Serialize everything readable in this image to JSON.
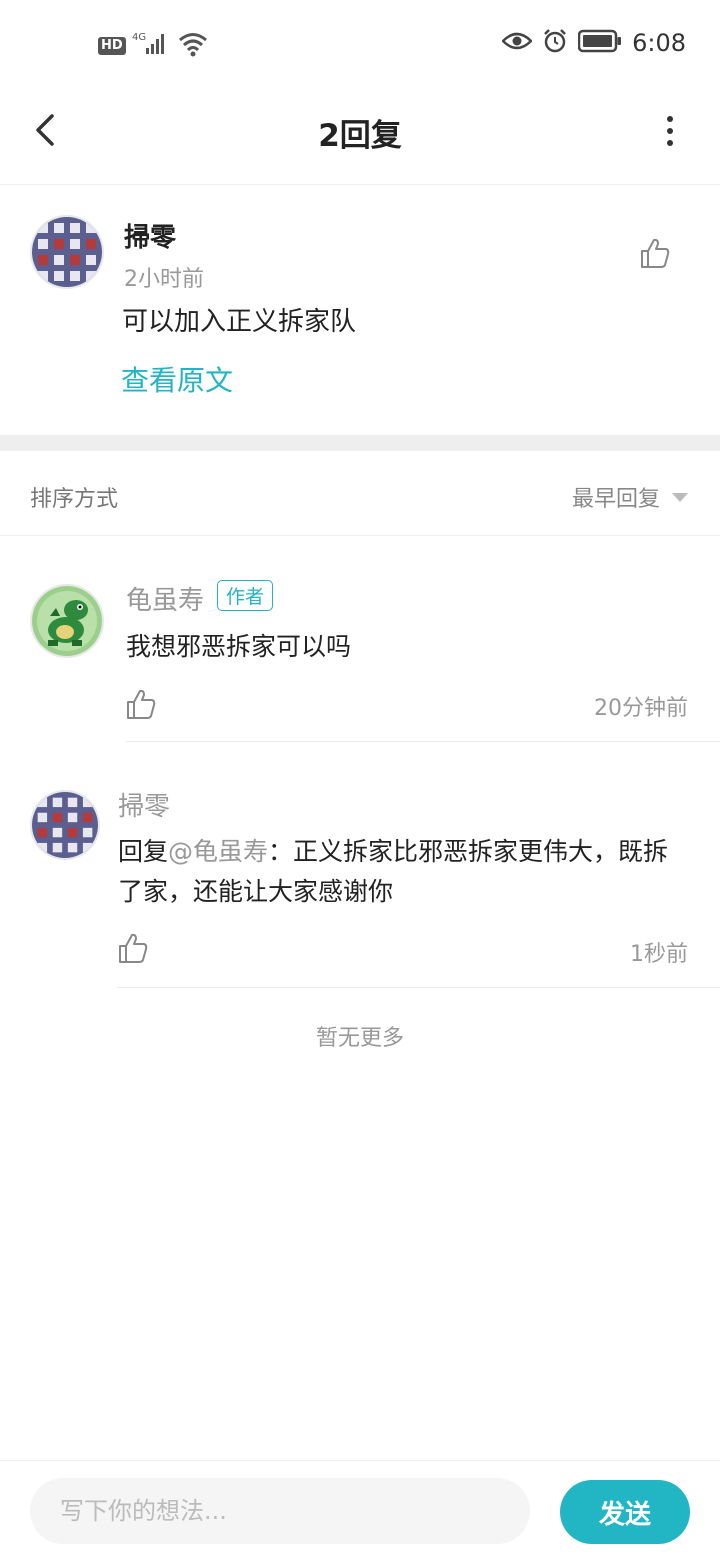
{
  "status_bar": {
    "hd_label": "HD",
    "network": "4G",
    "time": "6:08",
    "icons": [
      "signal-icon",
      "wifi-icon",
      "eye-icon",
      "alarm-icon",
      "battery-icon"
    ]
  },
  "header": {
    "title": "2回复",
    "icons": [
      "back-arrow-icon",
      "more-vertical-icon"
    ]
  },
  "post": {
    "author": "掃零",
    "time": "2小时前",
    "text": "可以加入正义拆家队",
    "view_original": "查看原文"
  },
  "sort": {
    "label": "排序方式",
    "selected": "最早回复"
  },
  "replies": [
    {
      "author": "龟虽寿",
      "badge": "作者",
      "text": "我想邪恶拆家可以吗",
      "time": "20分钟前"
    },
    {
      "author": "掃零",
      "reply_prefix": "回复",
      "mention": "@龟虽寿",
      "text": "：正义拆家比邪恶拆家更伟大，既拆了家，还能让大家感谢你",
      "time": "1秒前"
    }
  ],
  "no_more": "暂无更多",
  "composer": {
    "placeholder": "写下你的想法...",
    "send_label": "发送"
  },
  "colors": {
    "accent": "#22b5c4",
    "divider": "#eeeeee"
  }
}
